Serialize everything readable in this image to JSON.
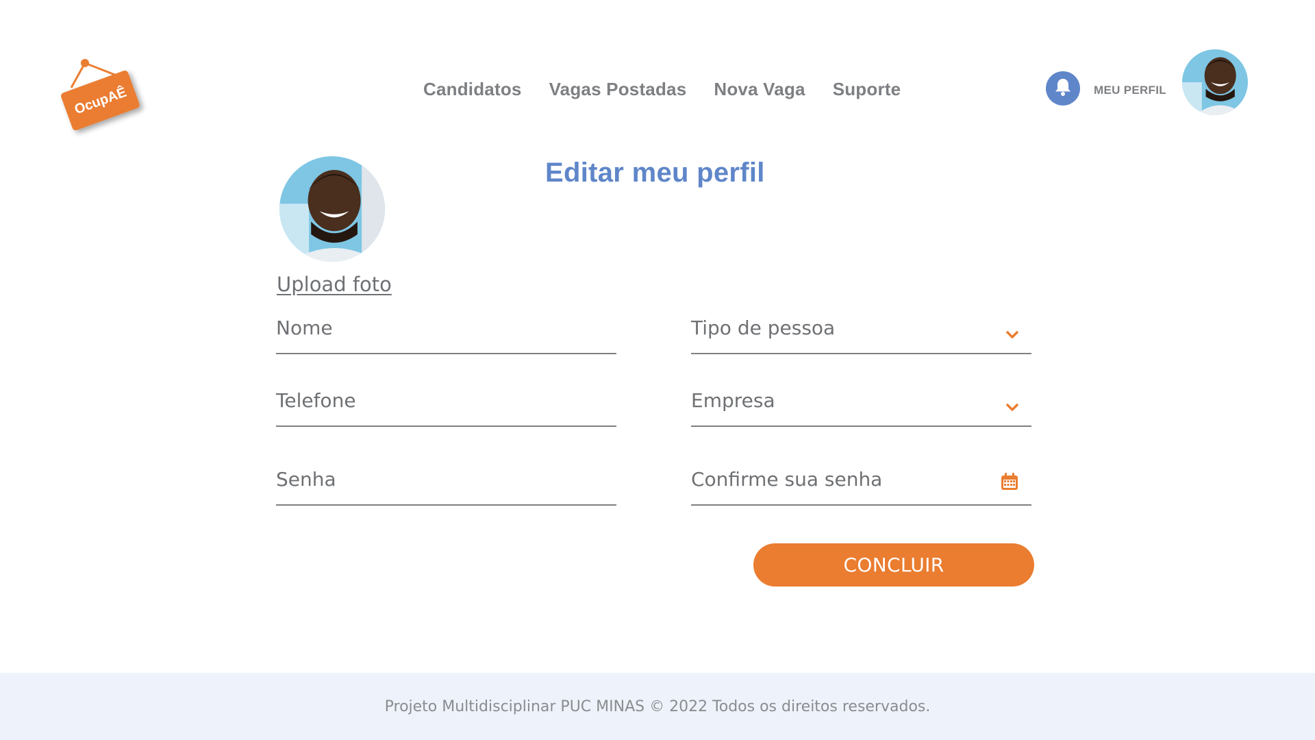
{
  "brand": {
    "logo_text": "OcupAÊ",
    "accent": "#ea7d30",
    "primary": "#5f86c9"
  },
  "nav": {
    "items": [
      {
        "label": "Candidatos"
      },
      {
        "label": "Vagas Postadas"
      },
      {
        "label": "Nova Vaga"
      },
      {
        "label": "Suporte"
      }
    ]
  },
  "header": {
    "notification_icon": "bell-icon",
    "profile_label": "MEU PERFIL"
  },
  "profile": {
    "title": "Editar meu perfil",
    "upload_label": "Upload foto"
  },
  "form": {
    "nome": "Nome",
    "tipo_pessoa": "Tipo  de pessoa",
    "telefone": "Telefone",
    "empresa": "Empresa",
    "senha": "Senha",
    "confirme_senha": "Confirme sua senha",
    "dropdown_icon": "chevron-down-icon",
    "calendar_icon": "calendar-icon",
    "submit_label": "CONCLUIR"
  },
  "footer": {
    "text": "Projeto Multidisciplinar  PUC MINAS © 2022 Todos os direitos reservados."
  }
}
